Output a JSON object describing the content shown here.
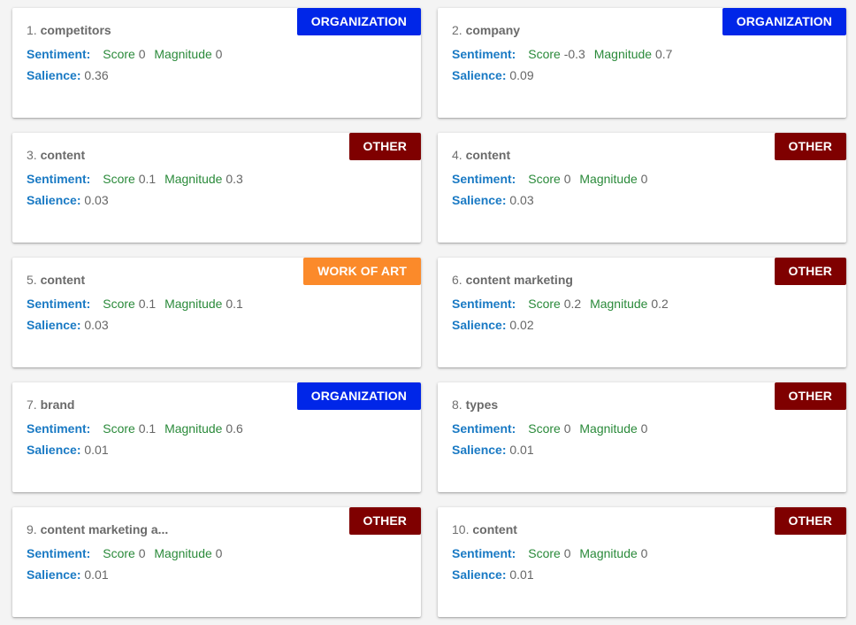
{
  "labels": {
    "sentiment": "Sentiment:",
    "score": "Score",
    "magnitude": "Magnitude",
    "salience": "Salience:"
  },
  "type_colors": {
    "ORGANIZATION": "#0026e8",
    "OTHER": "#7f0000",
    "WORK OF ART": "#fb8a2a"
  },
  "entities": [
    {
      "index": "1.",
      "name": "competitors",
      "type": "ORGANIZATION",
      "score": "0",
      "magnitude": "0",
      "salience": "0.36"
    },
    {
      "index": "2.",
      "name": "company",
      "type": "ORGANIZATION",
      "score": "-0.3",
      "magnitude": "0.7",
      "salience": "0.09"
    },
    {
      "index": "3.",
      "name": "content",
      "type": "OTHER",
      "score": "0.1",
      "magnitude": "0.3",
      "salience": "0.03"
    },
    {
      "index": "4.",
      "name": "content",
      "type": "OTHER",
      "score": "0",
      "magnitude": "0",
      "salience": "0.03"
    },
    {
      "index": "5.",
      "name": "content",
      "type": "WORK OF ART",
      "score": "0.1",
      "magnitude": "0.1",
      "salience": "0.03"
    },
    {
      "index": "6.",
      "name": "content marketing",
      "type": "OTHER",
      "score": "0.2",
      "magnitude": "0.2",
      "salience": "0.02"
    },
    {
      "index": "7.",
      "name": "brand",
      "type": "ORGANIZATION",
      "score": "0.1",
      "magnitude": "0.6",
      "salience": "0.01"
    },
    {
      "index": "8.",
      "name": "types",
      "type": "OTHER",
      "score": "0",
      "magnitude": "0",
      "salience": "0.01"
    },
    {
      "index": "9.",
      "name": "content marketing a...",
      "type": "OTHER",
      "score": "0",
      "magnitude": "0",
      "salience": "0.01"
    },
    {
      "index": "10.",
      "name": "content",
      "type": "OTHER",
      "score": "0",
      "magnitude": "0",
      "salience": "0.01"
    }
  ]
}
